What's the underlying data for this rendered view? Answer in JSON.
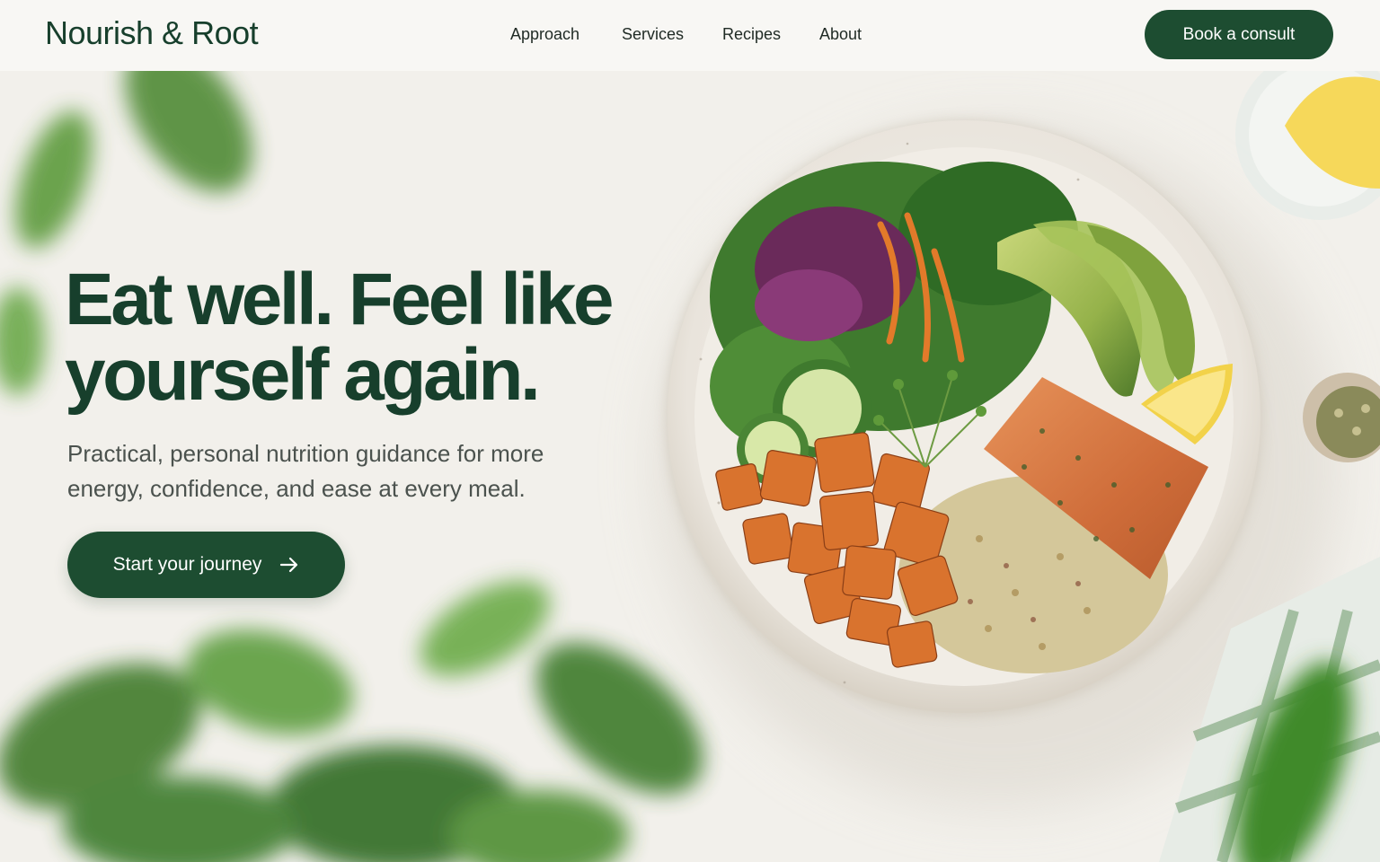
{
  "brand": {
    "name": "Nourish & Root"
  },
  "nav": {
    "items": [
      {
        "label": "Approach"
      },
      {
        "label": "Services"
      },
      {
        "label": "Recipes"
      },
      {
        "label": "About"
      }
    ],
    "cta_label": "Book a consult"
  },
  "hero": {
    "headline": "Eat well. Feel like yourself again.",
    "subheadline": "Practical, personal nutrition guidance for more energy, confidence, and ease at every meal.",
    "cta_label": "Start your journey",
    "cta_icon": "arrow-right-icon"
  },
  "colors": {
    "brand_green": "#1d4d31",
    "heading_green": "#173f2c",
    "background": "#f3f1ec",
    "body_text": "#4b524e"
  }
}
